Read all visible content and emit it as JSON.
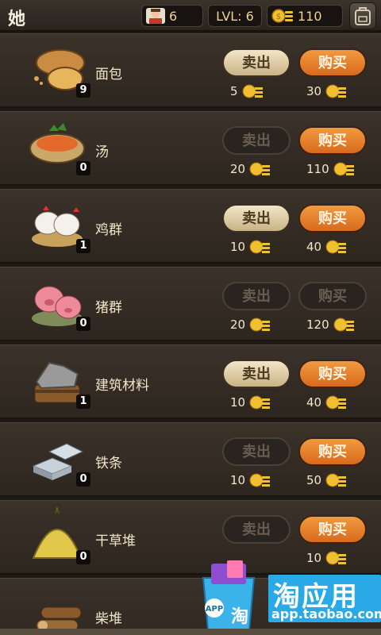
{
  "header": {
    "title": "她",
    "workers": "6",
    "level_text": "LVL: 6",
    "coins": "110",
    "icons": {
      "workers": "chef-avatar-icon",
      "coins": "gold-coins-icon",
      "bag": "backpack-icon"
    }
  },
  "items": [
    {
      "name": "面包",
      "count": "9",
      "sell_label": "卖出",
      "buy_label": "购买",
      "sell_price": "5",
      "buy_price": "30",
      "sell_enabled": true,
      "buy_enabled": true,
      "icon": "bread-icon"
    },
    {
      "name": "汤",
      "count": "0",
      "sell_label": "卖出",
      "buy_label": "购买",
      "sell_price": "20",
      "buy_price": "110",
      "sell_enabled": false,
      "buy_enabled": true,
      "icon": "soup-icon"
    },
    {
      "name": "鸡群",
      "count": "1",
      "sell_label": "卖出",
      "buy_label": "购买",
      "sell_price": "10",
      "buy_price": "40",
      "sell_enabled": true,
      "buy_enabled": true,
      "icon": "chickens-icon"
    },
    {
      "name": "猪群",
      "count": "0",
      "sell_label": "卖出",
      "buy_label": "购买",
      "sell_price": "20",
      "buy_price": "120",
      "sell_enabled": false,
      "buy_enabled": false,
      "icon": "pigs-icon"
    },
    {
      "name": "建筑材料",
      "count": "1",
      "sell_label": "卖出",
      "buy_label": "购买",
      "sell_price": "10",
      "buy_price": "40",
      "sell_enabled": true,
      "buy_enabled": true,
      "icon": "stones-icon"
    },
    {
      "name": "铁条",
      "count": "0",
      "sell_label": "卖出",
      "buy_label": "购买",
      "sell_price": "10",
      "buy_price": "50",
      "sell_enabled": false,
      "buy_enabled": true,
      "icon": "iron-bars-icon"
    },
    {
      "name": "干草堆",
      "count": "0",
      "sell_label": "卖出",
      "buy_label": "购买",
      "sell_price": "",
      "buy_price": "10",
      "sell_enabled": false,
      "buy_enabled": true,
      "icon": "haystack-icon"
    },
    {
      "name": "柴堆",
      "count": "",
      "sell_label": "",
      "buy_label": "",
      "sell_price": "",
      "buy_price": "",
      "sell_enabled": false,
      "buy_enabled": false,
      "icon": "firewood-icon"
    }
  ],
  "ad": {
    "title": "淘应用",
    "url": "app.taobao.com",
    "bag_text": "APP",
    "icon": "shopping-bag-icon"
  },
  "colors": {
    "buy_button": "#e07a2a",
    "sell_button": "#e7d6ad",
    "background": "#2f2822"
  }
}
